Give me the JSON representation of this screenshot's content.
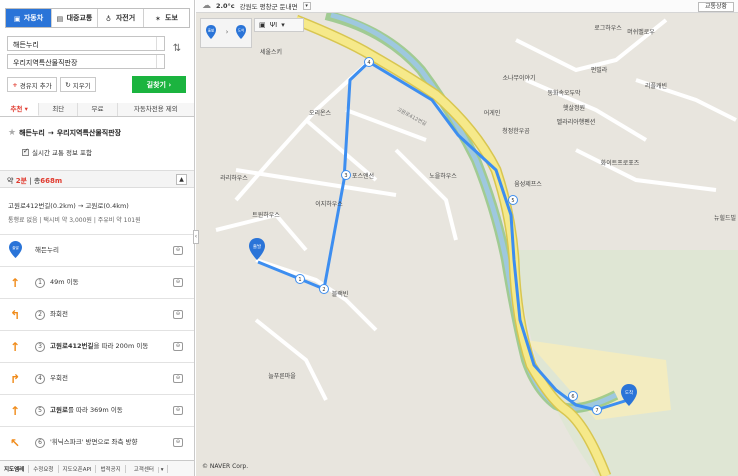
{
  "modes": [
    "자동차",
    "대중교통",
    "자전거",
    "도보"
  ],
  "origin": "해든누리",
  "destination": "우리지역특산물직판장",
  "buttons": {
    "waypoint": "경유지 추가",
    "clear": "지우기",
    "find": "길찾기 ›"
  },
  "tabs": [
    "추천",
    "최단",
    "무료",
    "자동차전용 제외"
  ],
  "route_title": {
    "from": "해든누리",
    "arrow": "→",
    "to": "우리지역특산물직판장"
  },
  "realtime_label": "실시간 교통 정보 포함",
  "summary": {
    "prefix": "약",
    "time": "2분",
    "sep": "|",
    "dist_label": "총",
    "dist": "668m"
  },
  "roads": "고원로412번길(0.2km) → 고원로(0.4km)",
  "fee": "통행료 없음 | 택시비 약 3,000원 | 주유비 약 101원",
  "steps": [
    {
      "type": "start",
      "pin": "출발",
      "text": "해든누리",
      "cam": "⊖"
    },
    {
      "type": "straight",
      "num": "1",
      "text": "49m 이동",
      "cam": "⊖"
    },
    {
      "type": "left",
      "num": "2",
      "text": "좌회전",
      "cam": "⊖"
    },
    {
      "type": "straight",
      "num": "3",
      "text_bold": "고원로412번길",
      "text": "을 따라 200m 이동",
      "cam": "⊖"
    },
    {
      "type": "right",
      "num": "4",
      "text": "우회전",
      "cam": "⊖"
    },
    {
      "type": "straight",
      "num": "5",
      "text_bold": "고원로",
      "text": "를 따라 369m 이동",
      "cam": "⊖"
    },
    {
      "type": "slight-left",
      "num": "6",
      "text": "'휘닉스파크' 방면으로 좌측 방향",
      "cam": "⊖"
    }
  ],
  "footer": [
    "지도엠레",
    "수정요청",
    "지도오픈API",
    "법적공지",
    "고객센터"
  ],
  "topbar": {
    "temp": "2.0°c",
    "location": "강원도 평창군 둔내면",
    "traffic": "교통상황"
  },
  "mini_labels": {
    "start": "출발",
    "end": "도착"
  },
  "map_labels": [
    "로그하우스",
    "머쉬벨로우",
    "소나무이야기",
    "동화속오두막",
    "펀빌라",
    "리플캐빈",
    "어게인",
    "햇살정원",
    "벨라리아행펜션",
    "청정한우곰",
    "화이트프로포즈",
    "윰성제프스",
    "오리온스",
    "포스앤선",
    "이지하우스",
    "노을하우스",
    "라리하우스",
    "트윈하우스",
    "블랙빈",
    "늘푸른마을",
    "뉴힐드빌",
    "세울스키",
    "고원로412번길"
  ],
  "route_markers": [
    "1",
    "2",
    "3",
    "4",
    "5",
    "6",
    "7"
  ],
  "copyright": "© NAVER Corp."
}
